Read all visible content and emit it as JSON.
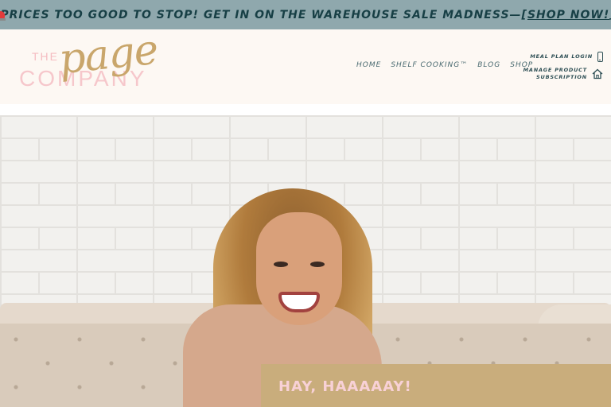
{
  "promo": {
    "icon": "siren-icon",
    "text": "PRICES TOO GOOD TO STOP! GET IN ON THE WAREHOUSE SALE MADNESS—",
    "link_open": "[",
    "link_label": "SHOP NOW!",
    "link_close": "]"
  },
  "logo": {
    "the": "THE",
    "page": "page",
    "company": "COMPANY"
  },
  "nav": {
    "items": [
      "HOME",
      "SHELF COOKING™",
      "BLOG",
      "SHOP"
    ]
  },
  "account": {
    "login_label": "MEAL PLAN LOGIN",
    "login_icon": "phone-icon",
    "manage_line1": "MANAGE PRODUCT",
    "manage_line2": "SUBSCRIPTION",
    "manage_icon": "home-icon"
  },
  "hero": {
    "image": "woman-on-sofa-photo",
    "callout_heading": "HAY, HAAAAAY!"
  },
  "colors": {
    "promo_bg": "#8fa8ad",
    "promo_text": "#173f45",
    "header_bg": "#fdf8f3",
    "logo_gold": "#c9a66b",
    "logo_pink": "#f6c7cb",
    "callout_bg": "#c9ad7c",
    "callout_text": "#f8d1d6"
  }
}
